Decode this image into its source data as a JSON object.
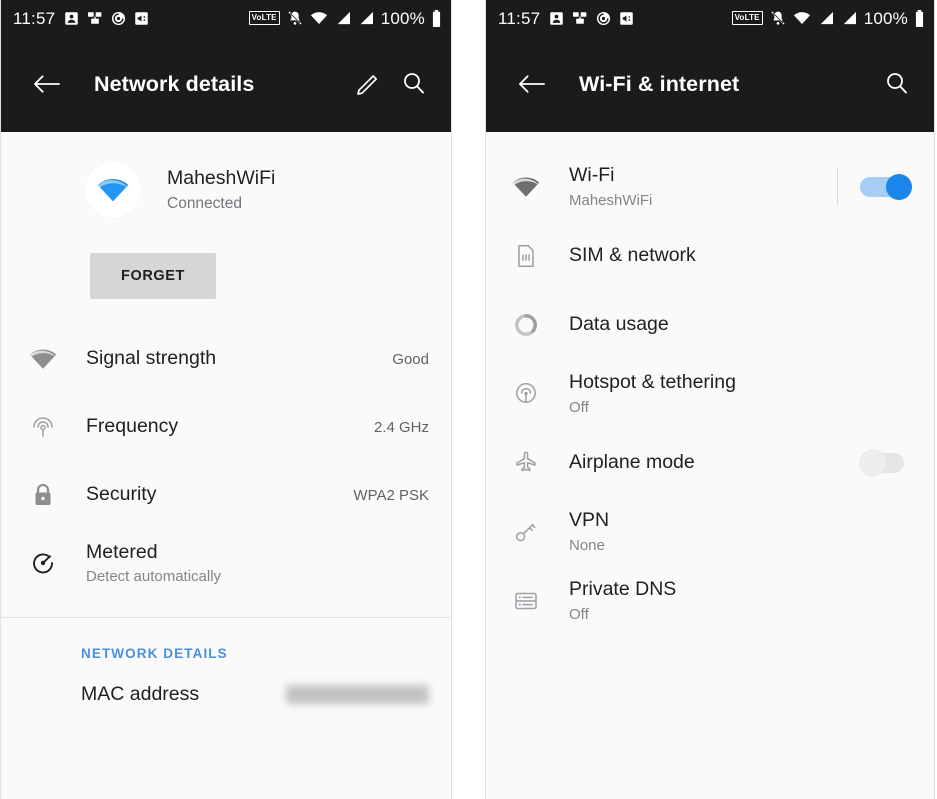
{
  "status_bar": {
    "clock": "11:57",
    "battery_percent": "100%",
    "volte_label": "VoLTE",
    "left_icons": [
      "contact-icon",
      "sms-icon",
      "screen-record-icon",
      "media-icon"
    ],
    "right_icons": [
      "volte-icon",
      "notifications-muted-icon",
      "wifi-icon",
      "signal-sim1-icon",
      "signal-sim2-icon",
      "battery-icon"
    ]
  },
  "left_panel": {
    "appbar": {
      "title": "Network details",
      "back_icon": "back-arrow-icon",
      "edit_icon": "pencil-icon",
      "search_icon": "search-icon"
    },
    "network": {
      "ssid": "MaheshWiFi",
      "state": "Connected",
      "icon": "wifi-icon",
      "accent": "#1a86ea"
    },
    "forget_label": "FORGET",
    "rows": [
      {
        "icon": "wifi-signal-icon",
        "title": "Signal strength",
        "value": "Good",
        "sub": ""
      },
      {
        "icon": "frequency-icon",
        "title": "Frequency",
        "value": "2.4 GHz",
        "sub": ""
      },
      {
        "icon": "lock-icon",
        "title": "Security",
        "value": "WPA2 PSK",
        "sub": ""
      },
      {
        "icon": "speedometer-icon",
        "title": "Metered",
        "value": "",
        "sub": "Detect automatically"
      }
    ],
    "section_label": "NETWORK DETAILS",
    "section_label_color": "#4a90d9",
    "mac": {
      "title": "MAC address",
      "value": ""
    }
  },
  "right_panel": {
    "appbar": {
      "title": "Wi-Fi & internet",
      "back_icon": "back-arrow-icon",
      "search_icon": "search-icon"
    },
    "rows": [
      {
        "icon": "wifi-signal-icon",
        "title": "Wi-Fi",
        "sub": "MaheshWiFi",
        "toggle": "on"
      },
      {
        "icon": "sim-card-icon",
        "title": "SIM & network",
        "sub": "",
        "toggle": "none"
      },
      {
        "icon": "data-usage-icon",
        "title": "Data usage",
        "sub": "",
        "toggle": "none"
      },
      {
        "icon": "hotspot-icon",
        "title": "Hotspot & tethering",
        "sub": "Off",
        "toggle": "none"
      },
      {
        "icon": "airplane-icon",
        "title": "Airplane mode",
        "sub": "",
        "toggle": "off"
      },
      {
        "icon": "vpn-key-icon",
        "title": "VPN",
        "sub": "None",
        "toggle": "none"
      },
      {
        "icon": "private-dns-icon",
        "title": "Private DNS",
        "sub": "Off",
        "toggle": "none"
      }
    ]
  }
}
